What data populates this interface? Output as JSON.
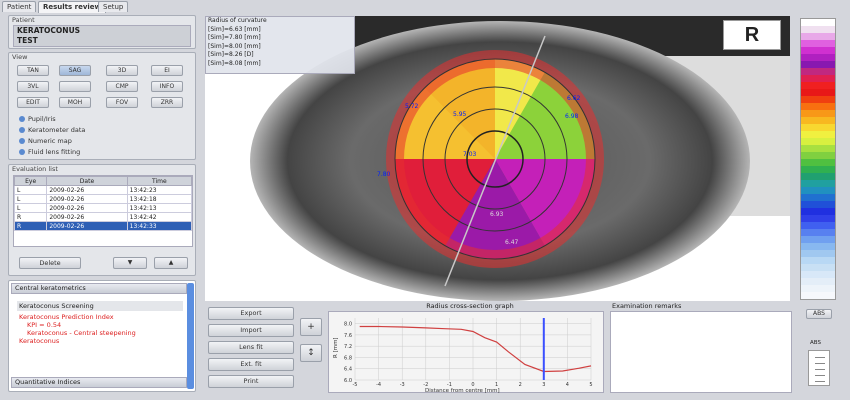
{
  "tabs": [
    {
      "label": "Patient"
    },
    {
      "label": "Results review"
    },
    {
      "label": "Setup"
    }
  ],
  "patient": {
    "title": "Patient",
    "name_line1": "KERATOCONUS",
    "name_line2": "TEST"
  },
  "view": {
    "title": "View",
    "buttons_row1": [
      "TAN",
      "SAG",
      "3D",
      "EI"
    ],
    "buttons_row2": [
      "3VL",
      "",
      "CMP",
      "INFO"
    ],
    "buttons_row3": [
      "EDIT",
      "MOH",
      "FOV",
      "ZRR"
    ],
    "options": [
      "Pupil/Iris",
      "Keratometer data",
      "Numeric map",
      "Fluid lens fitting"
    ]
  },
  "evaluation": {
    "title": "Evaluation list",
    "headers": [
      "Eye",
      "Date",
      "Time"
    ],
    "rows": [
      {
        "eye": "L",
        "date": "2009-02-26",
        "time": "13:42:23"
      },
      {
        "eye": "L",
        "date": "2009-02-26",
        "time": "13:42:18"
      },
      {
        "eye": "L",
        "date": "2009-02-26",
        "time": "13:42:13"
      },
      {
        "eye": "R",
        "date": "2009-02-26",
        "time": "13:42:42"
      },
      {
        "eye": "R",
        "date": "2009-02-26",
        "time": "13:42:33"
      }
    ],
    "delete_label": "Delete"
  },
  "keratometrics": {
    "header": "Central keratometrics",
    "screening_label": "Keratoconus Screening",
    "line1": "Keratoconus Prediction Index",
    "line2": "KPI = 0.54",
    "line3": "Keratoconus - Central steepening",
    "line4": "Keratoconus",
    "footer": "Quantitative Indices"
  },
  "info_box": {
    "title": "Radius of curvature",
    "lines": [
      "[Sim]=6.63 [mm]",
      "[Sim]=7.80 [mm]",
      "[Sim]=8.00 [mm]",
      "[Sim]=8.26 [D]",
      "[Sim]=8.08 [mm]"
    ]
  },
  "eye_label": "R",
  "map_values": [
    {
      "text": "5.72"
    },
    {
      "text": "5.95"
    },
    {
      "text": "6.98"
    },
    {
      "text": "7.03"
    },
    {
      "text": "7.80"
    },
    {
      "text": "6.93"
    },
    {
      "text": "6.47"
    },
    {
      "text": "6.62"
    }
  ],
  "bottom_buttons": [
    "Export",
    "Import",
    "Lens fit",
    "Ext. fit",
    "Print"
  ],
  "zoom_buttons": [
    "+",
    "↕"
  ],
  "graph": {
    "title": "Radius cross-section graph",
    "ylabel": "R [mm]",
    "xlabel": "Distance from centre [mm]",
    "y_ticks": [
      "8.0",
      "7.6",
      "7.2",
      "6.8",
      "6.4",
      "6.0"
    ],
    "x_ticks": [
      "-5",
      "-4",
      "-3",
      "-2",
      "-1",
      "0",
      "1",
      "2",
      "3",
      "4",
      "5"
    ]
  },
  "chart_data": {
    "type": "line",
    "title": "Radius cross-section graph",
    "xlabel": "Distance from centre [mm]",
    "ylabel": "R [mm]",
    "xlim": [
      -5,
      5
    ],
    "ylim": [
      6.0,
      8.2
    ],
    "series": [
      {
        "x": [
          -4.8,
          -4,
          -3,
          -2,
          -1.2,
          -0.5,
          0,
          0.5,
          1,
          1.5,
          2.2,
          3,
          3.8,
          4.5,
          5
        ],
        "y": [
          7.9,
          7.9,
          7.88,
          7.85,
          7.82,
          7.8,
          7.72,
          7.5,
          7.35,
          7.0,
          6.55,
          6.3,
          6.32,
          6.42,
          6.5
        ]
      }
    ],
    "marker_x": 3.0,
    "grid": true
  },
  "exam_remarks": {
    "title": "Examination remarks"
  },
  "right_small": {
    "label": "ABS",
    "btn": "ABS"
  },
  "colors": {
    "accent": "#2e5fb5",
    "marker": "#3a4fff"
  }
}
